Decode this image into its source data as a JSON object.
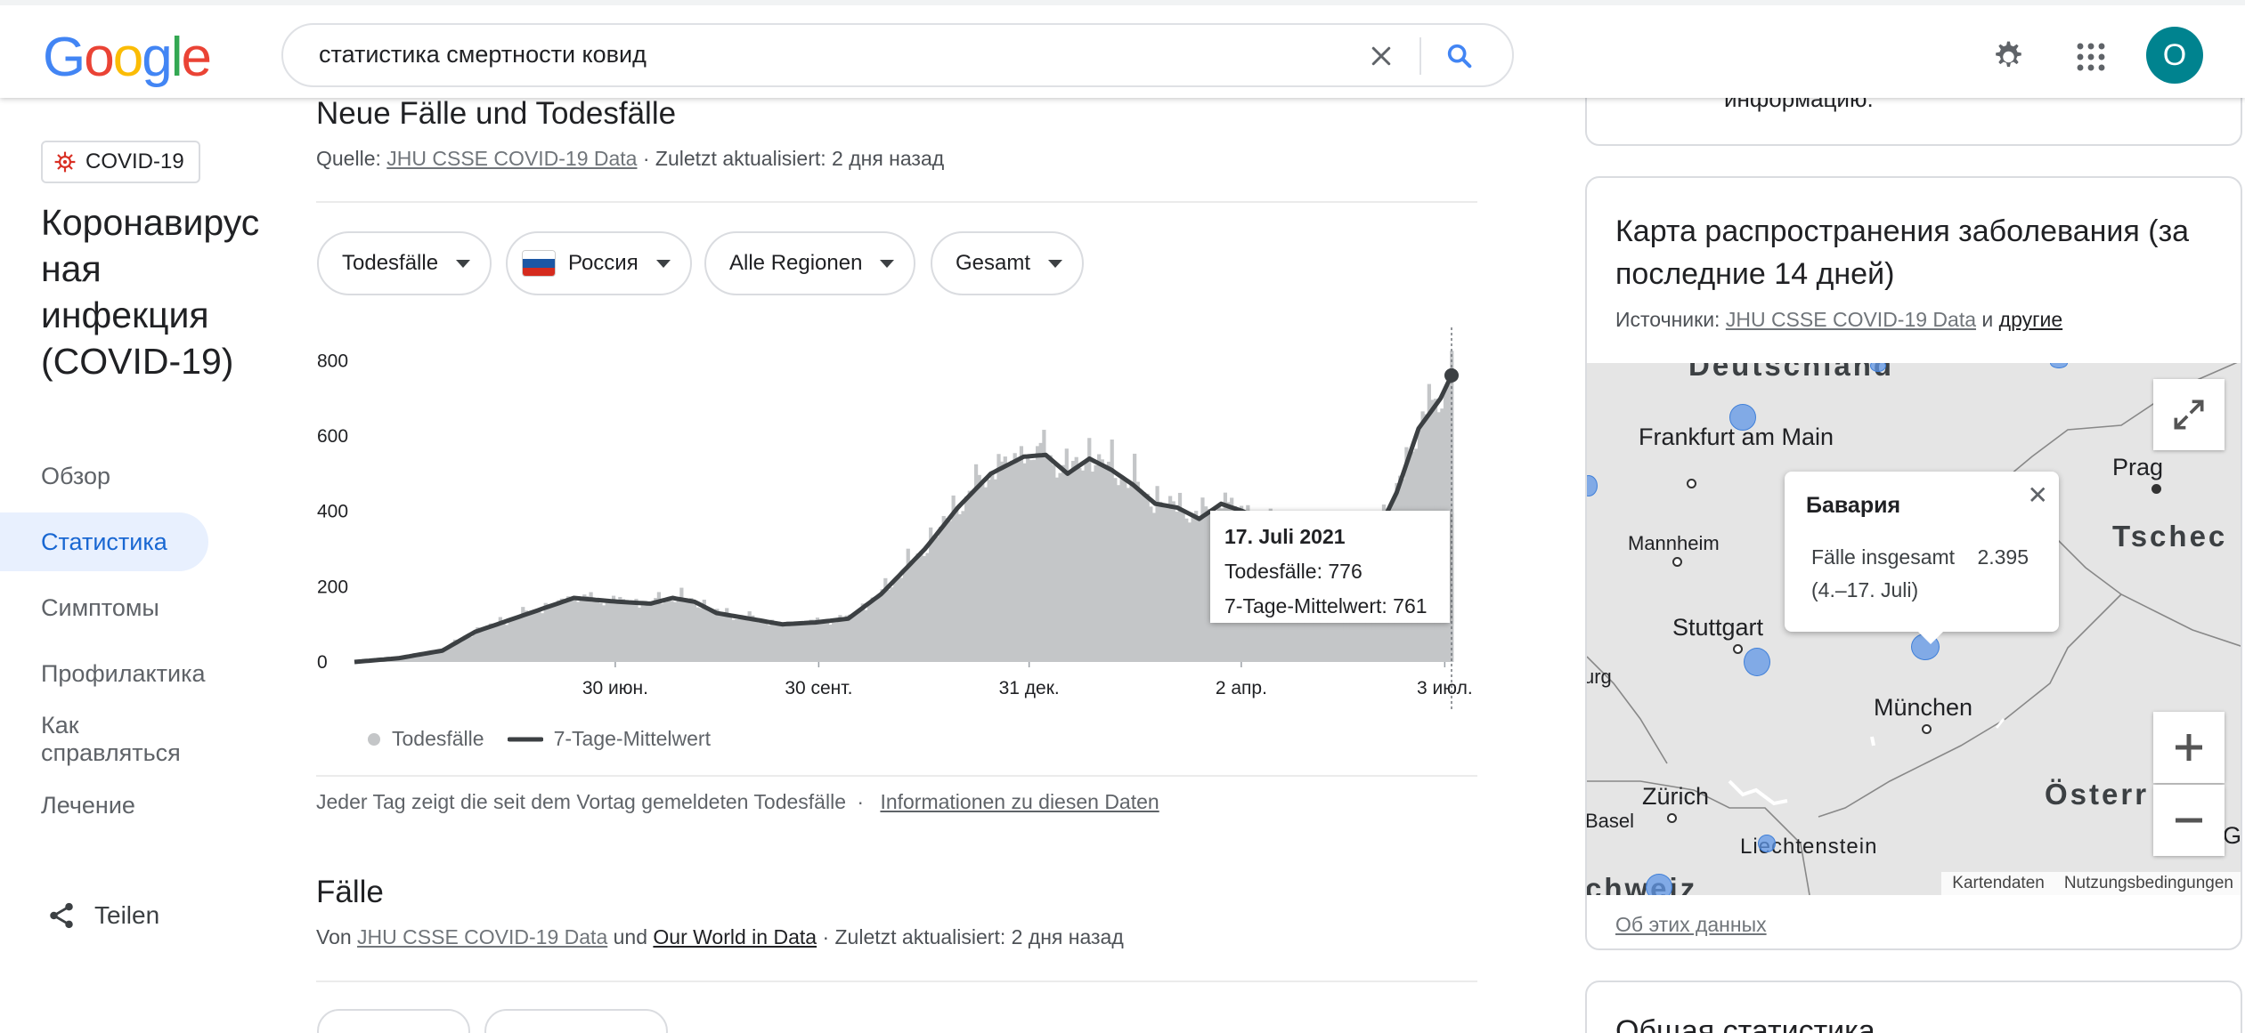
{
  "header": {
    "logo": [
      "G",
      "o",
      "o",
      "g",
      "l",
      "e"
    ],
    "logo_colors": [
      "#4285F4",
      "#EA4335",
      "#FBBC05",
      "#4285F4",
      "#34A853",
      "#EA4335"
    ],
    "query": "статистика смертности ковид",
    "avatar_letter": "O"
  },
  "sidebar": {
    "chip_label": "COVID-19",
    "title": "Коронавирусная инфекция (COVID-19)",
    "items": [
      {
        "label": "Обзор"
      },
      {
        "label": "Статистика"
      },
      {
        "label": "Симптомы"
      },
      {
        "label": "Профилактика"
      },
      {
        "label": "Как справляться"
      },
      {
        "label": "Лечение"
      }
    ],
    "active_index": 1,
    "share_label": "Teilen"
  },
  "deaths": {
    "title": "Neue Fälle und Todesfälle",
    "source_prefix": "Quelle:",
    "source_link": "JHU CSSE COVID-19 Data",
    "updated": "· Zuletzt aktualisiert: 2 дня назад",
    "filters": {
      "metric": "Todesfälle",
      "country": "Россия",
      "region": "Alle Regionen",
      "period": "Gesamt"
    },
    "tooltip": {
      "date": "17. Juli 2021",
      "deaths_label": "Todesfälle:",
      "deaths_value": "776",
      "avg_label": "7-Tage-Mittelwert:",
      "avg_value": "761"
    },
    "legend": {
      "series1": "Todesfälle",
      "series2": "7-Tage-Mittelwert"
    },
    "footnote": "Jeder Tag zeigt die seit dem Vortag gemeldeten Todesfälle",
    "footnote_sep": "·",
    "info_link": "Informationen zu diesen Daten"
  },
  "cases": {
    "title": "Fälle",
    "source_prefix": "Von",
    "source_link1": "JHU CSSE COVID-19 Data",
    "conj": "und",
    "source_link2": "Our World in Data",
    "updated": "· Zuletzt aktualisiert: 2 дня назад"
  },
  "right_panel": {
    "top_card_text": "информацию.",
    "map_title": "Карта распространения заболевания (за последние 14 дней)",
    "sources_prefix": "Источники:",
    "sources_link": "JHU CSSE COVID-19 Data",
    "sources_conj": "и",
    "sources_other": "другие",
    "cities": {
      "deutschland": "Deutschland",
      "frankfurt": "Frankfurt am Main",
      "prag": "Prag",
      "tschech": "Tschec",
      "mannheim": "Mannheim",
      "stuttgart": "Stuttgart",
      "munchen": "München",
      "zurich": "Zürich",
      "oster": "Österr",
      "basel": "Basel",
      "liechtenstein": "Liechtenstein",
      "schweiz": "chweiz",
      "urg": "urg",
      "gr": "Gr"
    },
    "popup": {
      "region": "Бавария",
      "label": "Fälle insgesamt",
      "value": "2.395",
      "range": "(4.–17. Juli)"
    },
    "attrib1": "Kartendaten",
    "attrib2": "Nutzungsbedingungen",
    "about_link": "Об этих данных",
    "stats_title": "Общая статистика"
  },
  "chart_data": {
    "type": "area",
    "title": "",
    "xlabel": "",
    "ylabel": "",
    "x_ticks": [
      "30 июн.",
      "30 сент.",
      "31 дек.",
      "2 апр.",
      "3 июл."
    ],
    "y_ticks": [
      0,
      200,
      400,
      600,
      800
    ],
    "ylim": [
      0,
      860
    ],
    "grid": false,
    "legend_position": "bottom-left",
    "series": [
      {
        "name": "Todesfälle",
        "style": "bars",
        "color": "#c4c6c8"
      },
      {
        "name": "7-Tage-Mittelwert",
        "style": "line",
        "color": "#3c4043"
      }
    ],
    "moving_average": {
      "t": [
        0,
        0.04,
        0.08,
        0.11,
        0.15,
        0.2,
        0.24,
        0.27,
        0.29,
        0.31,
        0.33,
        0.36,
        0.39,
        0.42,
        0.45,
        0.48,
        0.52,
        0.55,
        0.58,
        0.61,
        0.63,
        0.65,
        0.67,
        0.69,
        0.71,
        0.73,
        0.75,
        0.77,
        0.79,
        0.81,
        0.83,
        0.85,
        0.87,
        0.89,
        0.91,
        0.93,
        0.95,
        0.97,
        0.99,
        1.0
      ],
      "y": [
        0,
        10,
        30,
        80,
        120,
        170,
        160,
        155,
        170,
        160,
        130,
        115,
        100,
        105,
        115,
        180,
        300,
        410,
        500,
        545,
        550,
        500,
        540,
        510,
        470,
        420,
        410,
        380,
        420,
        400,
        370,
        330,
        310,
        300,
        320,
        330,
        450,
        620,
        700,
        761
      ]
    },
    "highlight": {
      "date": "17. Juli 2021",
      "deaths": 776,
      "moving_average": 761
    }
  }
}
